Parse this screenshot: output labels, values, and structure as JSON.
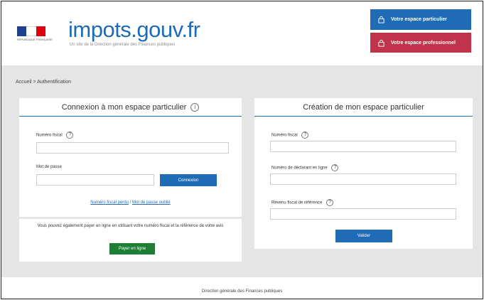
{
  "header": {
    "brand_name": "impots.gouv.fr",
    "brand_tagline": "Un site de la Direction générale des Finances publiques",
    "marianne_text": "RÉPUBLIQUE FRANÇAISE",
    "btn_particulier": "Votre espace particulier",
    "btn_professionnel": "Votre espace professionnel",
    "colors": {
      "blue": "#1f6bb5",
      "red": "#c0334a",
      "flag_blue": "#1f3f8f",
      "flag_red": "#e1000f"
    }
  },
  "breadcrumb": "Accueil > Authentification",
  "login": {
    "title": "Connexion à mon espace particulier",
    "title_icon": "info-icon",
    "numero_fiscal_label": "Numéro fiscal",
    "numero_fiscal_value": "",
    "password_label": "Mot de passe",
    "password_value": "",
    "connect_button": "Connexion",
    "forgot_numero_link": "Numéro fiscal perdu",
    "link_separator": "/",
    "forgot_password_link": "Mot de passe oublié"
  },
  "payment": {
    "text": "Vous pouvez également payer en ligne en utilisant votre numéro fiscal et la référence de votre avis",
    "button": "Payer en ligne"
  },
  "creation": {
    "title": "Création de mon espace particulier",
    "numero_fiscal_label": "Numéro fiscal",
    "numero_fiscal_value": "",
    "numero_declarant_label": "Numéro de déclarant en ligne",
    "numero_declarant_value": "",
    "revenu_fiscal_label": "Revenu fiscal de référence",
    "revenu_fiscal_value": "",
    "validate_button": "Valider"
  },
  "footer": "Direction générale des Finances publiques"
}
